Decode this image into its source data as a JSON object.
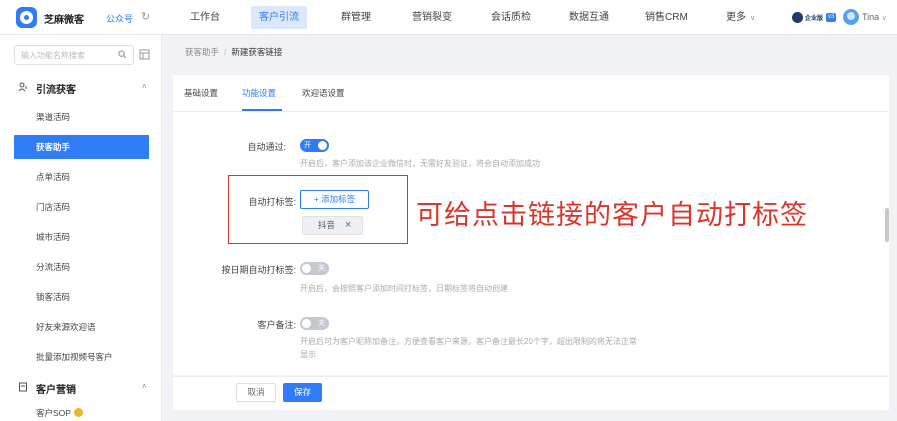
{
  "header": {
    "brand": "芝麻微客",
    "account": "公众号",
    "nav": [
      "工作台",
      "客户引流",
      "群管理",
      "营销裂变",
      "会话质检",
      "数据互通",
      "销售CRM",
      "更多"
    ],
    "active_nav": "客户引流",
    "edition_badge": "企业版",
    "version_badge": "v3",
    "user_name": "Tina"
  },
  "sidebar": {
    "search_placeholder": "输入功能名称搜索",
    "groups": [
      {
        "label": "引流获客",
        "items": [
          "渠道活码",
          "获客助手",
          "点单活码",
          "门店活码",
          "城市活码",
          "分流活码",
          "锁客活码",
          "好友来源欢迎语",
          "批量添加视频号客户"
        ]
      },
      {
        "label": "客户营销",
        "items": [
          "客户SOP"
        ]
      }
    ],
    "active_item": "获客助手"
  },
  "breadcrumb": {
    "parent": "获客助手",
    "separator": "/",
    "current": "新建获客链接"
  },
  "tabs": [
    "基础设置",
    "功能设置",
    "欢迎语设置"
  ],
  "active_tab": "功能设置",
  "form": {
    "auto_pass": {
      "label": "自动通过:",
      "toggle_text": "开",
      "enabled": true,
      "hint": "开启后，客户添加该企业微信时，无需好友验证，将会自动添加成功"
    },
    "auto_tag": {
      "label": "自动打标签:",
      "add_button": "添加标签",
      "tags": [
        "抖音"
      ]
    },
    "date_tag": {
      "label": "按日期自动打标签:",
      "toggle_text": "关",
      "enabled": false,
      "hint": "开启后，会按照客户添加时间打标签，日期标签将自动创建"
    },
    "remark": {
      "label": "客户备注:",
      "toggle_text": "关",
      "enabled": false,
      "hint_line1": "开启后可为客户昵称加备注，方便查看客户来源，客户备注最长20个字，超出限制的将无法正常",
      "hint_line2": "显示"
    }
  },
  "annotation_text": "可给点击链接的客户自动打标签",
  "footer": {
    "cancel": "取消",
    "save": "保存"
  },
  "colors": {
    "primary": "#2f7cf6",
    "annotation_red": "#d9362b"
  }
}
